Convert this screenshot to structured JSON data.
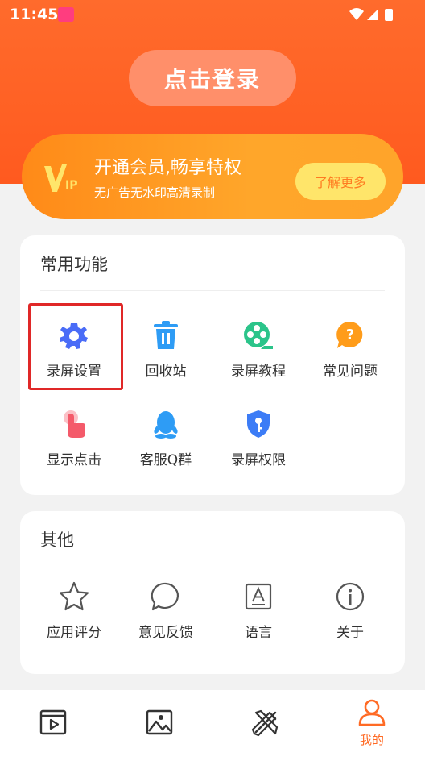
{
  "status": {
    "time": "11:45"
  },
  "login": {
    "label": "点击登录"
  },
  "vip": {
    "title": "开通会员,畅享特权",
    "subtitle": "无广告无水印高清录制",
    "button": "了解更多"
  },
  "common": {
    "title": "常用功能",
    "items": [
      {
        "label": "录屏设置",
        "icon": "gear-icon",
        "color": "#4a6cf7"
      },
      {
        "label": "回收站",
        "icon": "trash-icon",
        "color": "#2e9cf5"
      },
      {
        "label": "录屏教程",
        "icon": "film-reel-icon",
        "color": "#2bc48a"
      },
      {
        "label": "常见问题",
        "icon": "question-bubble-icon",
        "color": "#ff9c1a"
      },
      {
        "label": "显示点击",
        "icon": "tap-finger-icon",
        "color": "#f45a6a"
      },
      {
        "label": "客服Q群",
        "icon": "qq-penguin-icon",
        "color": "#2e9cf5"
      },
      {
        "label": "录屏权限",
        "icon": "shield-key-icon",
        "color": "#3c7cf6"
      }
    ]
  },
  "other": {
    "title": "其他",
    "items": [
      {
        "label": "应用评分",
        "icon": "star-icon"
      },
      {
        "label": "意见反馈",
        "icon": "chat-bubble-icon"
      },
      {
        "label": "语言",
        "icon": "language-icon"
      },
      {
        "label": "关于",
        "icon": "info-icon"
      }
    ]
  },
  "tabbar": {
    "active_color": "#ff6a24",
    "tabs": [
      {
        "label": "",
        "icon": "video-tab-icon"
      },
      {
        "label": "",
        "icon": "image-tab-icon"
      },
      {
        "label": "",
        "icon": "tools-tab-icon"
      },
      {
        "label": "我的",
        "icon": "profile-tab-icon"
      }
    ]
  }
}
